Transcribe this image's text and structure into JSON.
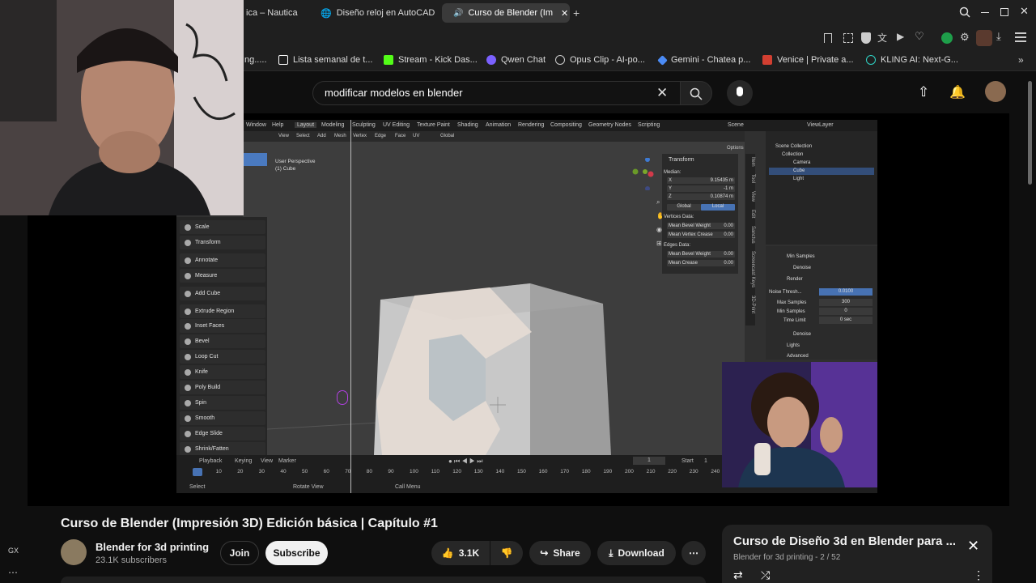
{
  "browser": {
    "tabs": [
      {
        "label": "ica – Nautica",
        "active": false
      },
      {
        "label": "Diseño reloj en AutoCAD",
        "active": false
      },
      {
        "label": "Curso de Blender (Im",
        "active": true
      }
    ],
    "bookmarks": [
      {
        "label": "ng.....",
        "color": "#888888"
      },
      {
        "label": "Lista semanal de t...",
        "color": "#ffffff"
      },
      {
        "label": "Stream - Kick Das...",
        "color": "#53fc18"
      },
      {
        "label": "Qwen Chat",
        "color": "#7b61ff"
      },
      {
        "label": "Opus Clip - AI-po...",
        "color": "#cccccc"
      },
      {
        "label": "Gemini - Chatea p...",
        "color": "#4b8bf5"
      },
      {
        "label": "Venice | Private a...",
        "color": "#d23f31"
      },
      {
        "label": "KLING AI: Next-G...",
        "color": "#2fd3c5"
      }
    ]
  },
  "youtube": {
    "search_query": "modificar modelos en blender"
  },
  "blender": {
    "menu": [
      "Window",
      "Help",
      "Layout",
      "Modeling",
      "Sculpting",
      "UV Editing",
      "Texture Paint",
      "Shading",
      "Animation",
      "Rendering",
      "Compositing",
      "Geometry Nodes",
      "Scripting"
    ],
    "scene_label": "Scene",
    "view_layer": "ViewLayer",
    "header_items": [
      "View",
      "Select",
      "Add",
      "Mesh",
      "Vertex",
      "Edge",
      "Face",
      "UV"
    ],
    "transform_mode": "Global",
    "viewport_label": "User Perspective",
    "viewport_object": "(1) Cube",
    "tools": [
      "Scale",
      "Transform",
      "Annotate",
      "Measure",
      "Add Cube",
      "Extrude Region",
      "Inset Faces",
      "Bevel",
      "Loop Cut",
      "Knife",
      "Poly Build",
      "Spin",
      "Smooth",
      "Edge Slide",
      "Shrink/Fatten"
    ],
    "transform": {
      "title": "Transform",
      "median": "Median:",
      "x_label": "X",
      "x": "9.15435 m",
      "y_label": "Y",
      "y": "-1 m",
      "z_label": "Z",
      "z": "0.10874 m",
      "global": "Global",
      "local": "Local",
      "vertices_data": "Vertices Data:",
      "mean_bevel_weight_1": "Mean Bevel Weight",
      "mbw1": "0.00",
      "mean_vertex_crease": "Mean Vertex Crease",
      "mvc": "0.00",
      "edges_data": "Edges Data:",
      "mean_bevel_weight_2": "Mean Bevel Weight",
      "mbw2": "0.00",
      "mean_crease": "Mean Crease",
      "mc": "0.00",
      "options": "Options"
    },
    "sidebar_tabs": [
      "Item",
      "Tool",
      "View",
      "Edit",
      "Sanctus",
      "Screencast Keys",
      "3D-Print"
    ],
    "outliner": {
      "scene_collection": "Scene Collection",
      "collection": "Collection",
      "items": [
        "Camera",
        "Cube",
        "Light"
      ]
    },
    "render": {
      "samples": "Min Samples",
      "denoise": "Denoise",
      "render": "Render",
      "noise_thresh_label": "Noise Thresh...",
      "noise_thresh": "0.0100",
      "max_samples_label": "Max Samples",
      "max_samples": "300",
      "min_samples_label": "Min Samples",
      "min_samples": "0",
      "time_limit_label": "Time Limit",
      "time_limit": "0 sec",
      "denoise2": "Denoise",
      "lights": "Lights",
      "advanced": "Advanced"
    },
    "timeline": {
      "playback": "Playback",
      "keying": "Keying",
      "view": "View",
      "marker": "Marker",
      "current_frame": "1",
      "start_label": "Start",
      "start": "1",
      "ticks": [
        "1",
        "10",
        "20",
        "30",
        "40",
        "50",
        "60",
        "70",
        "80",
        "90",
        "100",
        "110",
        "120",
        "130",
        "140",
        "150",
        "160",
        "170",
        "180",
        "190",
        "200",
        "210",
        "220",
        "230",
        "240"
      ],
      "status": [
        "Select",
        "Rotate View",
        "Call Menu"
      ]
    }
  },
  "video": {
    "title": "Curso de Blender (Impresión 3D) Edición básica | Capítulo #1",
    "channel": "Blender for 3d printing",
    "subscribers": "23.1K subscribers",
    "join": "Join",
    "subscribe": "Subscribe",
    "likes": "3.1K",
    "share": "Share",
    "download": "Download"
  },
  "playlist": {
    "title": "Curso de Diseño 3d en Blender para ...",
    "subtitle": "Blender for 3d printing - 2 / 52"
  },
  "side_label": "GX"
}
